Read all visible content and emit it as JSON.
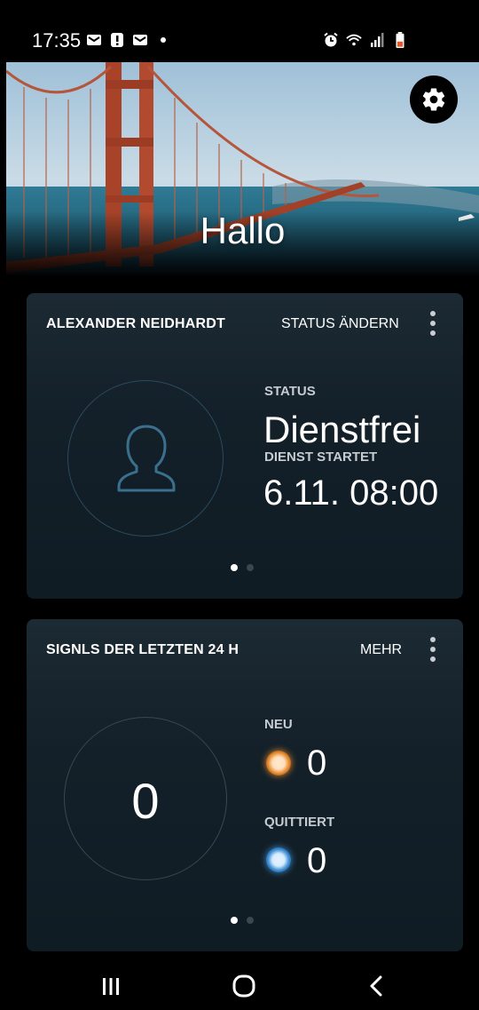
{
  "status_bar": {
    "time": "17:35",
    "left_icons": [
      "mail-icon",
      "alert-icon",
      "mail-icon",
      "dot-icon"
    ],
    "right_icons": [
      "alarm-icon",
      "wifi-icon",
      "signal-icon",
      "battery-low-icon"
    ]
  },
  "header": {
    "greeting": "Hallo",
    "settings_icon": "gear-icon"
  },
  "status_card": {
    "title": "ALEXANDER NEIDHARDT",
    "action_label": "STATUS ÄNDERN",
    "avatar_icon": "person-icon",
    "status_label": "STATUS",
    "status_value": "Dienstfrei",
    "start_label": "DIENST STARTET",
    "start_value": "6.11. 08:00",
    "page_count": 2,
    "active_page": 1
  },
  "signals_card": {
    "title": "SIGNLS DER LETZTEN 24 H",
    "action_label": "MEHR",
    "total": "0",
    "new_label": "NEU",
    "new_value": "0",
    "acked_label": "QUITTIERT",
    "acked_value": "0",
    "page_count": 2,
    "active_page": 1
  },
  "colors": {
    "card_bg": "#132029",
    "new_indicator": "#e8892b",
    "acked_indicator": "#3d8fd6",
    "ring": "#2a4a5e"
  },
  "nav_bar": {
    "items": [
      "recent-apps-icon",
      "home-icon",
      "back-icon"
    ]
  }
}
